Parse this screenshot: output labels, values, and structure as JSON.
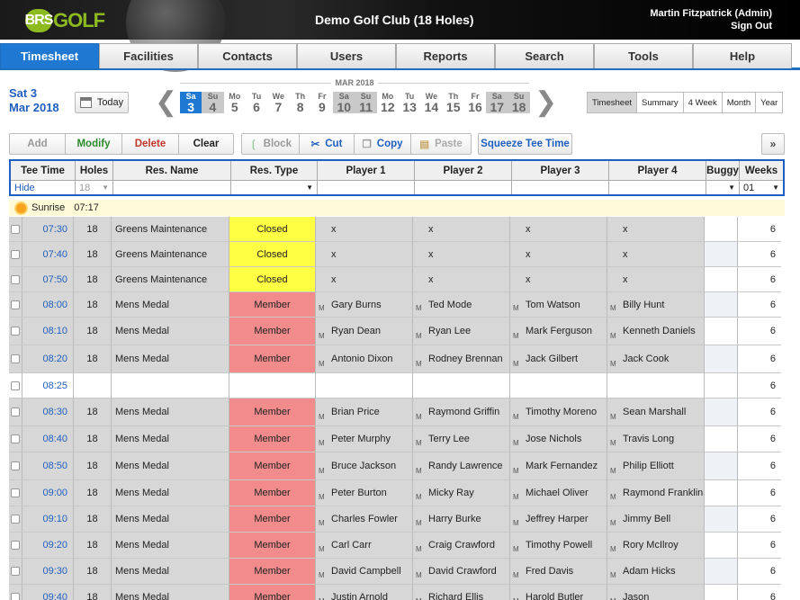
{
  "header": {
    "brand_a": "BRS",
    "brand_b": "GOLF",
    "club": "Demo Golf Club (18 Holes)",
    "user": "Martin Fitzpatrick (Admin)",
    "signout": "Sign Out"
  },
  "nav": [
    "Timesheet",
    "Facilities",
    "Contacts",
    "Users",
    "Reports",
    "Search",
    "Tools",
    "Help"
  ],
  "date": {
    "line1": "Sat 3",
    "line2": "Mar 2018",
    "today": "Today",
    "month": "MAR 2018"
  },
  "days": [
    [
      "Sa",
      "3"
    ],
    [
      "Su",
      "4"
    ],
    [
      "Mo",
      "5"
    ],
    [
      "Tu",
      "6"
    ],
    [
      "We",
      "7"
    ],
    [
      "Th",
      "8"
    ],
    [
      "Fr",
      "9"
    ],
    [
      "Sa",
      "10"
    ],
    [
      "Su",
      "11"
    ],
    [
      "Mo",
      "12"
    ],
    [
      "Tu",
      "13"
    ],
    [
      "We",
      "14"
    ],
    [
      "Th",
      "15"
    ],
    [
      "Fr",
      "16"
    ],
    [
      "Sa",
      "17"
    ],
    [
      "Su",
      "18"
    ]
  ],
  "views": [
    "Timesheet",
    "Summary",
    "4 Week",
    "Month",
    "Year"
  ],
  "toolbar": {
    "add": "Add",
    "modify": "Modify",
    "delete": "Delete",
    "clear": "Clear",
    "block": "Block",
    "cut": "Cut",
    "copy": "Copy",
    "paste": "Paste",
    "squeeze": "Squeeze Tee Time",
    "collapse": "»"
  },
  "columns": [
    "Tee Time",
    "Holes",
    "Res. Name",
    "Res. Type",
    "Player 1",
    "Player 2",
    "Player 3",
    "Player 4",
    "Buggy",
    "Weeks"
  ],
  "filters": {
    "hide": "Hide",
    "holes": "18",
    "weeks": "01"
  },
  "sunrise": {
    "label": "Sunrise",
    "time": "07:17"
  },
  "rows": [
    {
      "t": "07:30",
      "h": "18",
      "n": "Greens Maintenance",
      "ty": "Closed",
      "p": [
        "x",
        "x",
        "x",
        "x"
      ],
      "w": "6"
    },
    {
      "t": "07:40",
      "h": "18",
      "n": "Greens Maintenance",
      "ty": "Closed",
      "p": [
        "x",
        "x",
        "x",
        "x"
      ],
      "w": "6"
    },
    {
      "t": "07:50",
      "h": "18",
      "n": "Greens Maintenance",
      "ty": "Closed",
      "p": [
        "x",
        "x",
        "x",
        "x"
      ],
      "w": "6"
    },
    {
      "t": "08:00",
      "h": "18",
      "n": "Mens Medal",
      "ty": "Member",
      "p": [
        "Gary Burns",
        "Ted Mode",
        "Tom Watson",
        "Billy Hunt"
      ],
      "w": "6"
    },
    {
      "t": "08:10",
      "h": "18",
      "n": "Mens Medal",
      "ty": "Member",
      "p": [
        "Ryan Dean",
        "Ryan Lee",
        "Mark Ferguson",
        "Kenneth Daniels"
      ],
      "w": "6"
    },
    {
      "t": "08:20",
      "h": "18",
      "n": "Mens Medal",
      "ty": "Member",
      "p": [
        "Antonio Dixon",
        "Rodney Brennan",
        "Jack Gilbert",
        "Jack Cook"
      ],
      "w": "6"
    },
    {
      "t": "08:25",
      "h": "",
      "n": "",
      "ty": "",
      "p": [
        "",
        "",
        "",
        ""
      ],
      "w": "6"
    },
    {
      "t": "08:30",
      "h": "18",
      "n": "Mens Medal",
      "ty": "Member",
      "p": [
        "Brian Price",
        "Raymond Griffin",
        "Timothy Moreno",
        "Sean Marshall"
      ],
      "w": "6"
    },
    {
      "t": "08:40",
      "h": "18",
      "n": "Mens Medal",
      "ty": "Member",
      "p": [
        "Peter Murphy",
        "Terry Lee",
        "Jose Nichols",
        "Travis Long"
      ],
      "w": "6"
    },
    {
      "t": "08:50",
      "h": "18",
      "n": "Mens Medal",
      "ty": "Member",
      "p": [
        "Bruce Jackson",
        "Randy Lawrence",
        "Mark Fernandez",
        "Philip Elliott"
      ],
      "w": "6"
    },
    {
      "t": "09:00",
      "h": "18",
      "n": "Mens Medal",
      "ty": "Member",
      "p": [
        "Peter Burton",
        "Micky Ray",
        "Michael Oliver",
        "Raymond Franklin"
      ],
      "w": "6"
    },
    {
      "t": "09:10",
      "h": "18",
      "n": "Mens Medal",
      "ty": "Member",
      "p": [
        "Charles Fowler",
        "Harry Burke",
        "Jeffrey Harper",
        "Jimmy Bell"
      ],
      "w": "6"
    },
    {
      "t": "09:20",
      "h": "18",
      "n": "Mens Medal",
      "ty": "Member",
      "p": [
        "Carl Carr",
        "Craig Crawford",
        "Timothy Powell",
        "Rory McIlroy"
      ],
      "w": "6"
    },
    {
      "t": "09:30",
      "h": "18",
      "n": "Mens Medal",
      "ty": "Member",
      "p": [
        "David Campbell",
        "David Crawford",
        "Fred Davis",
        "Adam Hicks"
      ],
      "w": "6"
    },
    {
      "t": "09:40",
      "h": "18",
      "n": "Mens Medal",
      "ty": "Member",
      "p": [
        "Justin Arnold",
        "Richard Ellis",
        "Harold Butler",
        "Jason"
      ],
      "w": "6"
    }
  ]
}
